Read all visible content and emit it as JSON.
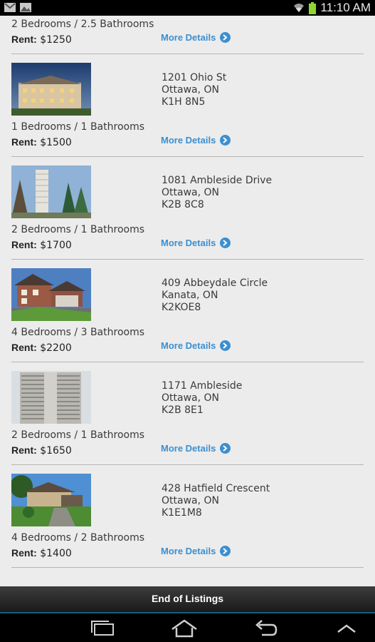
{
  "status_bar": {
    "time": "11:10 AM"
  },
  "listings_partial": {
    "beds_baths": "2 Bedrooms / 2.5 Bathrooms",
    "rent_label": "Rent:",
    "rent": "$1250",
    "more": "More Details"
  },
  "listings": [
    {
      "street": "1201 Ohio St",
      "city": "Ottawa, ON",
      "postal": "K1H 8N5",
      "beds_baths": "1 Bedrooms / 1 Bathrooms",
      "rent_label": "Rent:",
      "rent": "$1500",
      "more": "More Details"
    },
    {
      "street": "1081 Ambleside Drive",
      "city": "Ottawa, ON",
      "postal": "K2B 8C8",
      "beds_baths": "2 Bedrooms / 1 Bathrooms",
      "rent_label": "Rent:",
      "rent": "$1700",
      "more": "More Details"
    },
    {
      "street": "409 Abbeydale Circle",
      "city": "Kanata, ON",
      "postal": "K2KOE8",
      "beds_baths": "4 Bedrooms / 3 Bathrooms",
      "rent_label": "Rent:",
      "rent": "$2200",
      "more": "More Details"
    },
    {
      "street": "1171 Ambleside",
      "city": "Ottawa, ON",
      "postal": "K2B 8E1",
      "beds_baths": "2 Bedrooms / 1 Bathrooms",
      "rent_label": "Rent:",
      "rent": "$1650",
      "more": "More Details"
    },
    {
      "street": "428 Hatfield Crescent",
      "city": "Ottawa, ON",
      "postal": "K1E1M8",
      "beds_baths": "4 Bedrooms / 2 Bathrooms",
      "rent_label": "Rent:",
      "rent": "$1400",
      "more": "More Details"
    }
  ],
  "end_label": "End of Listings",
  "icons": {
    "status_left": [
      "gmail-icon",
      "gallery-icon"
    ],
    "status_right": [
      "wifi-icon",
      "battery-icon"
    ],
    "navigation": [
      "recent-apps-icon",
      "home-icon",
      "back-icon",
      "menu-up-icon"
    ]
  },
  "colors": {
    "link": "#3b8fd0",
    "accent_line": "#1a5b7a"
  }
}
